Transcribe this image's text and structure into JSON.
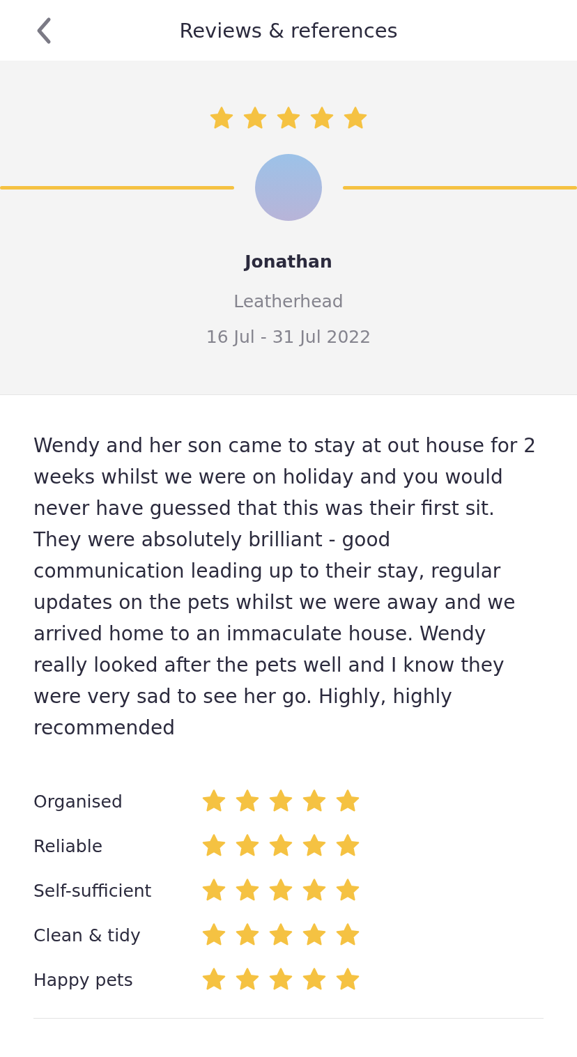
{
  "header": {
    "title": "Reviews & references"
  },
  "review": {
    "stars": 5,
    "name": "Jonathan",
    "location": "Leatherhead",
    "dates": "16 Jul - 31 Jul 2022",
    "text": "Wendy and her son came to stay at out house for 2 weeks whilst we were on holiday and you would never have guessed that this was their first sit. They were absolutely brilliant - good communication leading up to their stay, regular updates on the pets whilst we were away and we arrived home to an immaculate house. Wendy really looked after the pets well and I know they were very sad to see her go. Highly, highly recommended"
  },
  "ratings": [
    {
      "label": "Organised",
      "stars": 5
    },
    {
      "label": "Reliable",
      "stars": 5
    },
    {
      "label": "Self-sufficient",
      "stars": 5
    },
    {
      "label": "Clean & tidy",
      "stars": 5
    },
    {
      "label": "Happy pets",
      "stars": 5
    }
  ]
}
